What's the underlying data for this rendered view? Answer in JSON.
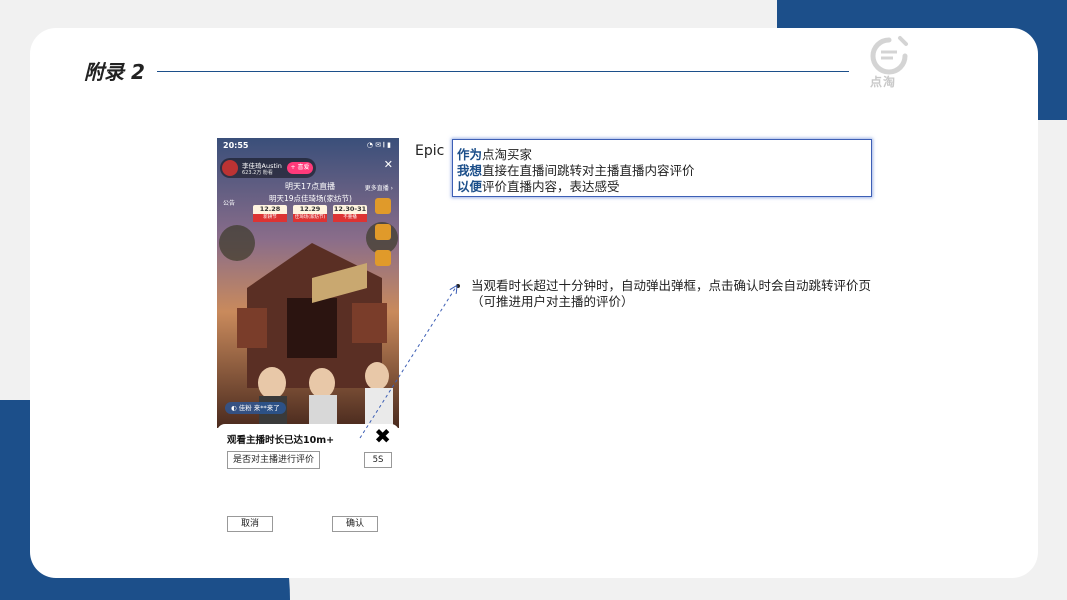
{
  "slide": {
    "title": "附录 2",
    "logo_text": "点淘"
  },
  "phone": {
    "status_time": "20:55",
    "status_right": "◔ ✉ 𝄃 ▮",
    "host_name": "李佳琦Austin",
    "host_fans": "623.2万 粉看",
    "follow_label": "+ 喜爱",
    "banner_line1": "明天17点直播",
    "banner_line2": "明天19点佳琦场(家纺节)",
    "more_live": "更多直播 ›",
    "notice": "公告",
    "dates": [
      {
        "date": "12.28",
        "label": "新耕节"
      },
      {
        "date": "12.29",
        "label": "佳琦场(家纺节)"
      },
      {
        "date": "12.30-31",
        "label": "不重播"
      }
    ],
    "comment_chip": "◐ 佳粉 来**来了",
    "popup": {
      "title": "观看主播时长已达10m+",
      "question": "是否对主播进行评价",
      "timer": "5S",
      "cancel": "取消",
      "confirm": "确认",
      "close_icon": "close-x-icon"
    }
  },
  "epic": {
    "label": "Epic",
    "lines": [
      {
        "key": "作为",
        "text": "点淘买家"
      },
      {
        "key": "我想",
        "text": "直接在直播间跳转对主播直播内容评价"
      },
      {
        "key": "以便",
        "text": "评价直播内容，表达感受"
      }
    ]
  },
  "note": {
    "text": "当观看时长超过十分钟时，自动弹出弹框，点击确认时会自动跳转评价页（可推进用户对主播的评价）"
  },
  "colors": {
    "brand_blue": "#1c4f8a",
    "epic_border": "#3d5fb5"
  }
}
